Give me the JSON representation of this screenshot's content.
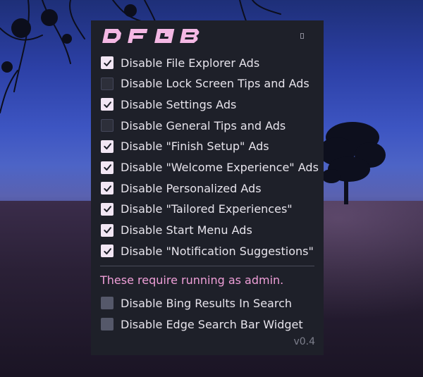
{
  "app": {
    "logo_text": "DFGB",
    "version": "v0.4"
  },
  "options": [
    {
      "label": "Disable File Explorer Ads",
      "checked": true
    },
    {
      "label": "Disable Lock Screen Tips and Ads",
      "checked": false
    },
    {
      "label": "Disable Settings Ads",
      "checked": true
    },
    {
      "label": "Disable General Tips and Ads",
      "checked": false
    },
    {
      "label": "Disable \"Finish Setup\" Ads",
      "checked": true
    },
    {
      "label": "Disable \"Welcome Experience\" Ads",
      "checked": true
    },
    {
      "label": "Disable Personalized Ads",
      "checked": true
    },
    {
      "label": "Disable \"Tailored Experiences\"",
      "checked": true
    },
    {
      "label": "Disable Start Menu Ads",
      "checked": true
    },
    {
      "label": "Disable \"Notification Suggestions\"",
      "checked": true
    }
  ],
  "admin": {
    "note": "These require running as admin.",
    "options": [
      {
        "label": "Disable Bing Results In Search",
        "checked": false,
        "disabled": true
      },
      {
        "label": "Disable Edge Search Bar Widget",
        "checked": false,
        "disabled": true
      }
    ]
  },
  "colors": {
    "panel_bg": "#1e2029",
    "accent_pink": "#ef9fd8",
    "checkbox_on": "#f2e6f4",
    "text": "#e7e4ec"
  },
  "icons": {
    "check": "checkmark-icon",
    "window_button": "restore-icon"
  }
}
